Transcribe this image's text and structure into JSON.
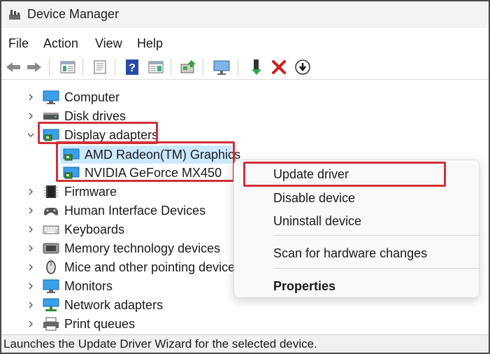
{
  "window": {
    "title": "Device Manager",
    "icon": "device-manager-icon"
  },
  "menu": {
    "items": [
      "File",
      "Action",
      "View",
      "Help"
    ]
  },
  "toolbar": {
    "buttons": [
      "back-arrow-icon",
      "forward-arrow-icon",
      "show-hide-tree-icon",
      "properties-sheet-icon",
      "help-icon",
      "action-pane-icon",
      "update-driver-icon",
      "scan-monitor-icon",
      "enable-device-icon",
      "uninstall-x-icon",
      "download-circle-icon"
    ]
  },
  "tree": {
    "nodes": [
      {
        "label": "Computer",
        "icon": "monitor-icon",
        "expanded": false
      },
      {
        "label": "Disk drives",
        "icon": "disk-drive-icon",
        "expanded": false
      },
      {
        "label": "Display adapters",
        "icon": "display-adapter-icon",
        "expanded": true
      },
      {
        "label": "AMD Radeon(TM) Graphics",
        "icon": "display-adapter-icon",
        "child": true,
        "selected": true
      },
      {
        "label": "NVIDIA GeForce MX450",
        "icon": "display-adapter-icon",
        "child": true
      },
      {
        "label": "Firmware",
        "icon": "firmware-chip-icon",
        "expanded": false
      },
      {
        "label": "Human Interface Devices",
        "icon": "hid-icon",
        "expanded": false
      },
      {
        "label": "Keyboards",
        "icon": "keyboard-icon",
        "expanded": false
      },
      {
        "label": "Memory technology devices",
        "icon": "memory-device-icon",
        "expanded": false
      },
      {
        "label": "Mice and other pointing devices",
        "icon": "mouse-icon",
        "expanded": false
      },
      {
        "label": "Monitors",
        "icon": "monitor-icon",
        "expanded": false
      },
      {
        "label": "Network adapters",
        "icon": "network-adapter-icon",
        "expanded": false
      },
      {
        "label": "Print queues",
        "icon": "printer-icon",
        "expanded": false
      }
    ]
  },
  "context_menu": {
    "update_driver": "Update driver",
    "disable_device": "Disable device",
    "uninstall_device": "Uninstall device",
    "scan": "Scan for hardware changes",
    "properties": "Properties"
  },
  "status": {
    "text": "Launches the Update Driver Wizard for the selected device."
  },
  "colors": {
    "highlight": "#d0303a",
    "selection": "#cce8ff"
  }
}
